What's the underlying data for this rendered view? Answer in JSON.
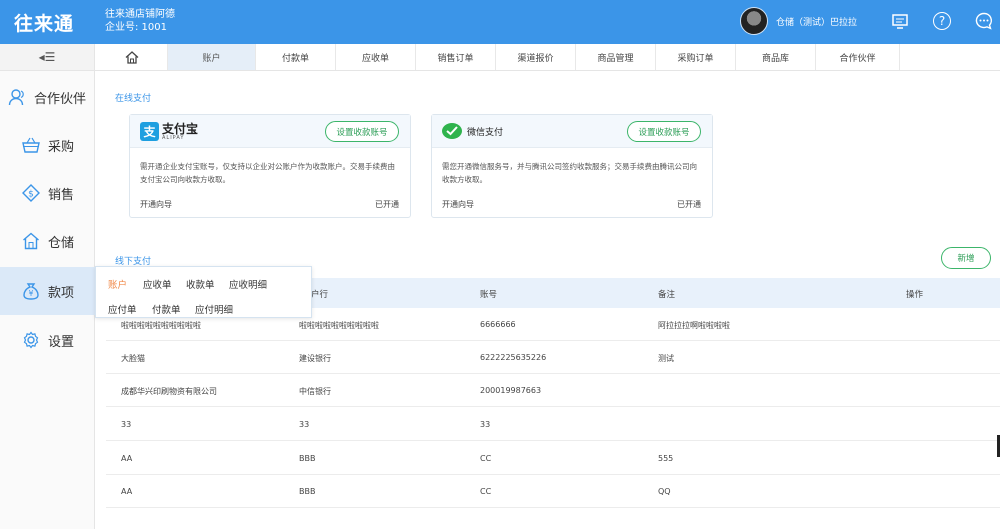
{
  "app": {
    "logo": "往来通",
    "store_name": "往来通店铺阿德",
    "company_label": "企业号: 1001"
  },
  "user": {
    "name": "仓储（测试）巴拉拉"
  },
  "menu_toggle": "◂☰",
  "tabs": [
    "账户",
    "付款单",
    "应收单",
    "销售订单",
    "渠道报价",
    "商品管理",
    "采购订单",
    "商品库",
    "合作伙伴"
  ],
  "sidebar": {
    "items": [
      {
        "label": "合作伙伴",
        "icon": "partner-icon"
      },
      {
        "label": "采购",
        "icon": "basket-icon"
      },
      {
        "label": "销售",
        "icon": "sales-tag-icon"
      },
      {
        "label": "仓储",
        "icon": "warehouse-icon"
      },
      {
        "label": "款项",
        "icon": "money-bag-icon"
      },
      {
        "label": "设置",
        "icon": "gear-icon"
      }
    ]
  },
  "popup_menu": {
    "row1": [
      "账户",
      "应收单",
      "收款单",
      "应收明细"
    ],
    "row2": [
      "应付单",
      "付款单",
      "应付明细"
    ]
  },
  "online_pay": {
    "title": "在线支付",
    "alipay": {
      "brand": "支付宝",
      "brand_sub": "ALIPAY",
      "button": "设置收款账号",
      "desc": "需开通企业支付宝账号，仅支持以企业对公账户作为收款账户。交易手续费由支付宝公司向收款方收取。",
      "guide": "开通向导",
      "status": "已开通"
    },
    "wechat": {
      "brand": "微信支付",
      "button": "设置收款账号",
      "desc": "需您开通微信服务号，并与腾讯公司签约收款服务；交易手续费由腾讯公司向收款方收取。",
      "guide": "开通向导",
      "status": "已开通"
    }
  },
  "offline_pay": {
    "title": "线下支付",
    "new_button": "新增",
    "columns": [
      "户行",
      "账号",
      "备注",
      "操作"
    ],
    "rows": [
      [
        "啦啦啦啦啦啦啦啦啦啦",
        "啦啦啦啦啦啦啦啦啦啦",
        "6666666",
        "阿拉拉拉啊啦啦啦啦"
      ],
      [
        "大脸猫",
        "建设银行",
        "6222225635226",
        "测试"
      ],
      [
        "成都华兴印刷物资有限公司",
        "中信银行",
        "200019987663",
        ""
      ],
      [
        "33",
        "33",
        "33",
        ""
      ],
      [
        "AA",
        "BBB",
        "CC",
        "555"
      ],
      [
        "AA",
        "BBB",
        "CC",
        "QQ"
      ]
    ]
  }
}
